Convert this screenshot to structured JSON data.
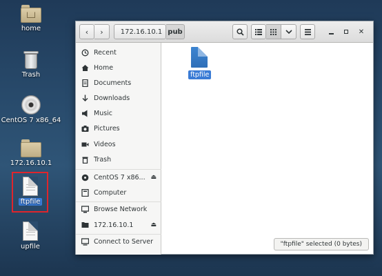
{
  "desktop": {
    "icons": [
      {
        "label": "home",
        "icon": "home-folder-icon"
      },
      {
        "label": "Trash",
        "icon": "trash-icon"
      },
      {
        "label": "CentOS 7 x86_64",
        "icon": "disc-icon"
      },
      {
        "label": "172.16.10.1",
        "icon": "network-folder-icon"
      },
      {
        "label": "ftpfile",
        "icon": "document-icon",
        "selected": true
      },
      {
        "label": "upfile",
        "icon": "document-icon"
      }
    ]
  },
  "window": {
    "path": [
      "172.16.10.1",
      "pub"
    ],
    "toolbar": {
      "search_icon": "search-icon",
      "list_view_icon": "list-view-icon",
      "grid_view_icon": "grid-view-icon",
      "view_options_icon": "chevron-down-icon",
      "menu_icon": "menu-icon"
    },
    "sidebar": {
      "places": [
        {
          "label": "Recent",
          "icon": "clock-icon"
        },
        {
          "label": "Home",
          "icon": "home-icon"
        },
        {
          "label": "Documents",
          "icon": "documents-icon"
        },
        {
          "label": "Downloads",
          "icon": "download-icon"
        },
        {
          "label": "Music",
          "icon": "music-icon"
        },
        {
          "label": "Pictures",
          "icon": "camera-icon"
        },
        {
          "label": "Videos",
          "icon": "video-icon"
        },
        {
          "label": "Trash",
          "icon": "trash-icon"
        }
      ],
      "devices": [
        {
          "label": "CentOS 7 x86...",
          "icon": "disc-icon"
        },
        {
          "label": "Computer",
          "icon": "computer-icon"
        }
      ],
      "network": [
        {
          "label": "Browse Network",
          "icon": "network-icon"
        },
        {
          "label": "172.16.10.1",
          "icon": "server-folder-icon"
        },
        {
          "label": "Connect to Server",
          "icon": "connect-icon"
        }
      ]
    },
    "files": [
      {
        "label": "ftpfile",
        "icon": "document-icon",
        "selected": true
      }
    ],
    "status": "\"ftpfile\" selected (0 bytes)"
  }
}
